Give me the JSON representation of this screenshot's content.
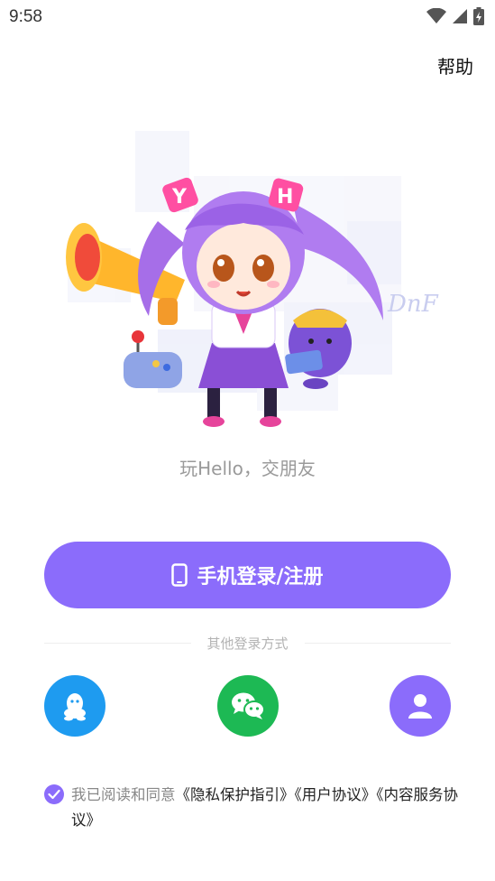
{
  "status_bar": {
    "time": "9:58"
  },
  "header": {
    "help_label": "帮助"
  },
  "hero": {
    "cap_letters": [
      "Y",
      "H"
    ],
    "watermark": "DnF"
  },
  "tagline": "玩Hello，交朋友",
  "login": {
    "label": "手机登录/注册"
  },
  "other_methods": {
    "label": "其他登录方式"
  },
  "social": [
    {
      "name": "qq",
      "color": "#1e9bf0"
    },
    {
      "name": "wechat",
      "color": "#1db954"
    },
    {
      "name": "account",
      "color": "#8b6cfb"
    }
  ],
  "agreement": {
    "prefix": "我已阅读和同意",
    "privacy": "《隐私保护指引》",
    "user": "《用户协议》",
    "content": "《内容服务协议》"
  },
  "colors": {
    "accent": "#8b6cfb",
    "qq": "#1e9bf0",
    "wechat": "#1db954"
  }
}
